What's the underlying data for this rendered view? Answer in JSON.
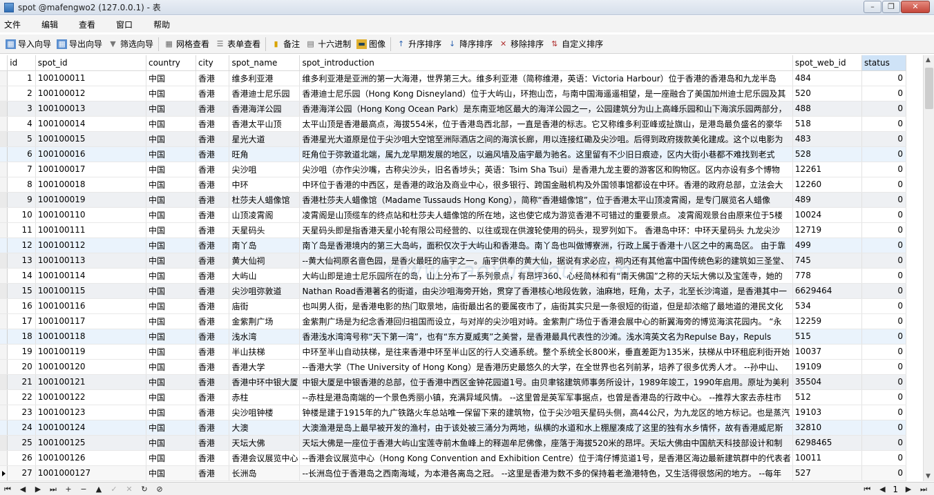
{
  "window": {
    "title": "spot @mafengwo2 (127.0.0.1) - 表",
    "minimize": "–",
    "maximize": "❐",
    "close": "✕"
  },
  "menu": [
    "文件",
    "编辑",
    "查看",
    "窗口",
    "帮助"
  ],
  "toolbar": {
    "import_wizard": "导入向导",
    "export_wizard": "导出向导",
    "filter_wizard": "筛选向导",
    "grid_view": "网格查看",
    "form_view": "表单查看",
    "memo": "备注",
    "hex": "十六进制",
    "image": "图像",
    "sort_asc": "升序排序",
    "sort_desc": "降序排序",
    "remove_sort": "移除排序",
    "custom_sort": "自定义排序"
  },
  "grid": {
    "columns": [
      "id",
      "spot_id",
      "country",
      "city",
      "spot_name",
      "spot_introduction",
      "spot_web_id",
      "status"
    ],
    "rows": [
      [
        "1",
        "100100011",
        "中国",
        "香港",
        "维多利亚港",
        "维多利亚港是亚洲的第一大海港，世界第三大。维多利亚港（简称维港，英语：Victoria Harbour）位于香港的香港岛和九龙半岛",
        "484",
        "0"
      ],
      [
        "2",
        "100100012",
        "中国",
        "香港",
        "香港迪士尼乐园",
        "香港迪士尼乐园（Hong Kong Disneyland）位于大屿山，环抱山峦，与南中国海遥遥相望，是一座融合了美国加州迪士尼乐园及其",
        "520",
        "0"
      ],
      [
        "3",
        "100100013",
        "中国",
        "香港",
        "香港海洋公园",
        "香港海洋公园（Hong Kong Ocean Park）是东南亚地区最大的海洋公园之一，公园建筑分为山上高峰乐园和山下海滨乐园两部分，",
        "488",
        "0"
      ],
      [
        "4",
        "100100014",
        "中国",
        "香港",
        "香港太平山顶",
        "太平山顶是香港最高点，海拔554米，位于香港岛西北部，一直是香港的标志。它又称维多利亚峰或扯旗山，是港岛最负盛名的豪华",
        "518",
        "0"
      ],
      [
        "5",
        "100100015",
        "中国",
        "香港",
        "星光大道",
        "香港星光大道原是位于尖沙咀大空馆至洲际酒店之间的海滨长廊，用以连接红磡及尖沙咀。后得到政府拨款美化建成。这个以电影为",
        "483",
        "0"
      ],
      [
        "6",
        "100100016",
        "中国",
        "香港",
        "旺角",
        "旺角位于弥敦道北端，属九龙早期发展的地区，以遍风墙及庙宇最为驰名。这里留有不少旧日痕迹，区内大街小巷都不难找到老式",
        "528",
        "0"
      ],
      [
        "7",
        "100100017",
        "中国",
        "香港",
        "尖沙咀",
        "尖沙咀（亦作尖沙嘴，古称尖沙头，旧名香埗头；英语：Tsim Sha Tsui）是香港九龙主要的游客区和购物区。区内亦设有多个博物",
        "12261",
        "0"
      ],
      [
        "8",
        "100100018",
        "中国",
        "香港",
        "中环",
        "中环位于香港的中西区，是香港的政治及商业中心，很多银行、跨国金融机构及外国领事馆都设在中环。香港的政府总部，立法会大",
        "12260",
        "0"
      ],
      [
        "9",
        "100100019",
        "中国",
        "香港",
        "杜莎夫人蜡像馆",
        "香港杜莎夫人蜡像馆（Madame Tussauds Hong Kong），简称“香港蜡像馆”，位于香港太平山顶凌霄阁，是专门展览名人蜡像",
        "489",
        "0"
      ],
      [
        "10",
        "100100110",
        "中国",
        "香港",
        "山顶凌霄阁",
        "凌霄阁是山顶缆车的终点站和杜莎夫人蜡像馆的所在地，这也使它成为游览香港不可错过的重要景点。 凌霄阁观景台由原来位于5楼",
        "10024",
        "0"
      ],
      [
        "11",
        "100100111",
        "中国",
        "香港",
        "天星码头",
        "天星码头即是指香港天星小轮有限公司经营的、以往或现在供渡轮使用的码头，现罗列如下。 香港岛中环：中环天星码头 九龙尖沙",
        "12719",
        "0"
      ],
      [
        "12",
        "100100112",
        "中国",
        "香港",
        "南丫岛",
        "南丫岛是香港境内的第三大岛屿，面积仅次于大屿山和香港岛。南丫岛也叫做博寮洲，行政上属于香港十八区之中的离岛区。 由于靠",
        "499",
        "0"
      ],
      [
        "13",
        "100100113",
        "中国",
        "香港",
        "黄大仙祠",
        "--黄大仙祠原名啬色园，是香火最旺的庙宇之一。庙宇供奉的黄大仙，据说有求必应，祠内还有其他富中国传统色彩的建筑如三圣堂、",
        "745",
        "0"
      ],
      [
        "14",
        "100100114",
        "中国",
        "香港",
        "大屿山",
        "大屿山即是迪士尼乐园所在的岛，山上分布了一系列景点，有昂坪360、心经简林和有“南天佛国”之称的天坛大佛以及宝莲寺，她的",
        "778",
        "0"
      ],
      [
        "15",
        "100100115",
        "中国",
        "香港",
        "尖沙咀弥敦道",
        "Nathan Road香港著名的街道，由尖沙咀海旁开始，贯穿了香港核心地段佐敦，油麻地，旺角，太子，北至长沙湾道，是香港其中一",
        "6629464",
        "0"
      ],
      [
        "16",
        "100100116",
        "中国",
        "香港",
        "庙街",
        "也叫男人街，是香港电影的热门取景地，庙街最出名的要属夜市了，庙街其实只是一条很短的街道，但是却浓缩了最地道的港民文化",
        "534",
        "0"
      ],
      [
        "17",
        "100100117",
        "中国",
        "香港",
        "金紫荆广场",
        "金紫荆广场是为纪念香港回归祖国而设立，与对岸的尖沙咀对峙。金紫荆广场位于香港会展中心的新翼海旁的博览海滨花园内。 “永",
        "12259",
        "0"
      ],
      [
        "18",
        "100100118",
        "中国",
        "香港",
        "浅水湾",
        "香港浅水湾湾号称“天下第一湾”，也有“东方夏威夷”之美誉，是香港最具代表性的沙滩。浅水湾英文名为Repulse Bay，Repuls",
        "515",
        "0"
      ],
      [
        "19",
        "100100119",
        "中国",
        "香港",
        "半山扶梯",
        "中环至半山自动扶梯，是往来香港中环至半山区的行人交通系统。整个系统全长800米，垂直差距为135米，扶梯从中环租庇利街开始",
        "10037",
        "0"
      ],
      [
        "20",
        "100100120",
        "中国",
        "香港",
        "香港大学",
        "--香港大学（The University of Hong Kong）是香港历史最悠久的大学，在全世界也名列前茅，培养了很多优秀人才。 --孙中山、",
        "19109",
        "0"
      ],
      [
        "21",
        "100100121",
        "中国",
        "香港",
        "香港中环中银大厦",
        "中银大厦是中银香港的总部，位于香港中西区金钟花园道1号。由贝聿铭建筑师事务所设计，1989年竣工，1990年启用。原址为美利",
        "35504",
        "0"
      ],
      [
        "22",
        "100100122",
        "中国",
        "香港",
        "赤柱",
        "--赤柱是港岛南端的一个景色秀丽小镇，充满异域风情。 --这里曾是英军军事据点，也曾是香港岛的行政中心。 --推荐大家去赤柱市",
        "512",
        "0"
      ],
      [
        "23",
        "100100123",
        "中国",
        "香港",
        "尖沙咀钟楼",
        "钟楼是建于1915年的九广铁路火车总站唯一保留下来的建筑物，位于尖沙咀天星码头侧，高44公尺，为九龙区的地方标记。也是蒸汽",
        "19103",
        "0"
      ],
      [
        "24",
        "100100124",
        "中国",
        "香港",
        "大澳",
        "大澳渔港是岛上最早被开发的渔村，由于该处被三涌分为两地，纵横的水道和水上棚屋凑成了这里的独有水乡情怀，故有香港威尼斯",
        "32810",
        "0"
      ],
      [
        "25",
        "100100125",
        "中国",
        "香港",
        "天坛大佛",
        "天坛大佛是一座位于香港大屿山宝莲寺前木鱼峰上的释迦牟尼佛像，座落于海拔520米的昂坪。天坛大佛由中国航天科技部设计和制",
        "6298465",
        "0"
      ],
      [
        "26",
        "100100126",
        "中国",
        "香港",
        "香港会议展览中心",
        "--香港会议展览中心（Hong Kong Convention and Exhibition Centre）位于湾仔博览道1号，是香港区海边最新建筑群中的代表者",
        "10011",
        "0"
      ],
      [
        "27",
        "1001000127",
        "中国",
        "香港",
        "长洲岛",
        "--长洲岛位于香港岛之西南海域，为本港各离岛之冠。 --这里是香港为数不多的保持着老渔港特色，又生活得很悠闲的地方。 --每年",
        "527",
        "0"
      ]
    ]
  },
  "watermark": "www.yaoxuegou.com",
  "status": {
    "page": "1"
  },
  "icons": {
    "import": "table-import-icon",
    "export": "table-export-icon",
    "filter": "funnel-icon",
    "grid": "grid-icon",
    "form": "form-icon",
    "memo": "note-icon",
    "hex": "hex-icon",
    "image": "image-icon",
    "sort_asc": "sort-asc-icon",
    "sort_desc": "sort-desc-icon",
    "remove_sort": "remove-sort-icon",
    "custom_sort": "custom-sort-icon"
  },
  "colors": {
    "selected_header": "#cfe3f7",
    "alt_row": "#eef0f3",
    "highlight_row": "#eaf3fc"
  }
}
